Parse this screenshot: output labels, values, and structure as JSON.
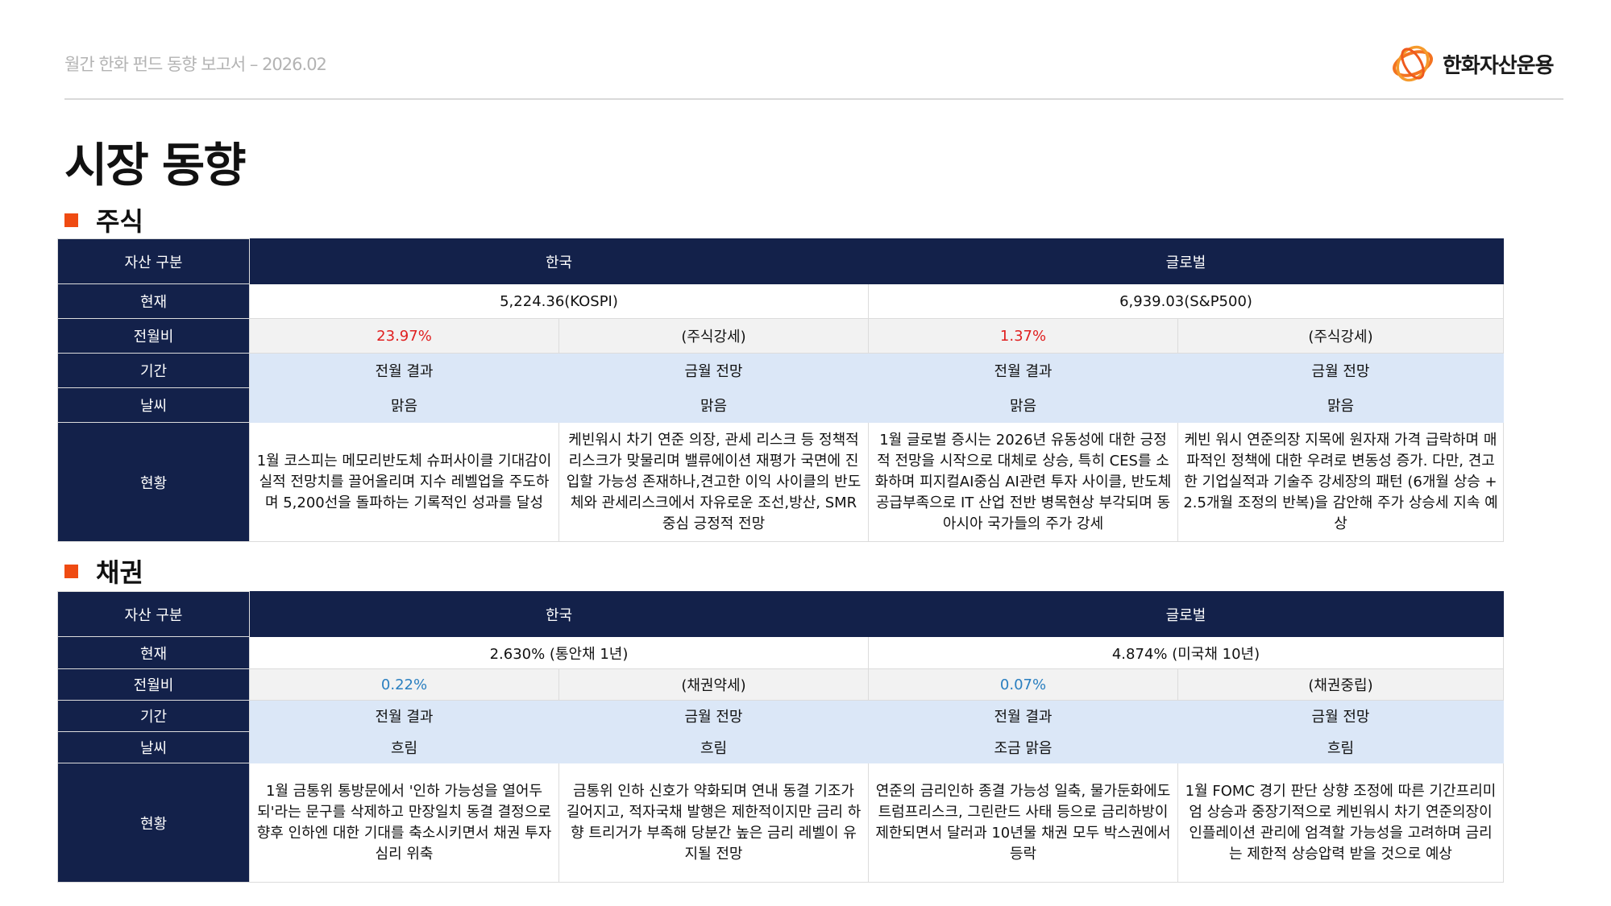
{
  "header": {
    "report_title": "월간 한화 펀드 동향 보고서 – 2026.02",
    "logo_text": "한화자산운용"
  },
  "page_title": "시장 동향",
  "colors": {
    "navy": "#13214a",
    "accent": "#ef4b12",
    "positive_red": "#e02020",
    "positive_blue": "#2a7fc0"
  },
  "stock": {
    "section_label": "주식",
    "rows": {
      "asset": "자산 구분",
      "current": "현재",
      "change": "전월비",
      "period": "기간",
      "weather": "날씨",
      "status": "현황"
    },
    "korea": {
      "label": "한국",
      "current": "5,224.36(KOSPI)",
      "change": "23.97%",
      "change_note": "(주식강세)",
      "period_prev": "전월 결과",
      "period_next": "금월 전망",
      "weather_prev": "맑음",
      "weather_next": "맑음",
      "status_prev": "1월 코스피는 메모리반도체 슈퍼사이클 기대감이 실적 전망치를 끌어올리며 지수 레벨업을 주도하며 5,200선을 돌파하는 기록적인 성과를 달성",
      "status_next": "케빈워시 차기 연준 의장, 관세 리스크 등 정책적 리스크가 맞물리며 밸류에이션 재평가 국면에 진입할 가능성 존재하나,견고한 이익 사이클의 반도체와 관세리스크에서 자유로운 조선,방산, SMR 중심 긍정적 전망"
    },
    "global": {
      "label": "글로벌",
      "current": "6,939.03(S&P500)",
      "change": "1.37%",
      "change_note": "(주식강세)",
      "period_prev": "전월 결과",
      "period_next": "금월 전망",
      "weather_prev": "맑음",
      "weather_next": "맑음",
      "status_prev": "1월 글로벌 증시는 2026년 유동성에 대한 긍정적 전망을 시작으로 대체로 상승, 특히 CES를 소화하며 피지컬AI중심 AI관련 투자 사이클, 반도체 공급부족으로 IT 산업 전반 병목현상 부각되며 동아시아 국가들의 주가 강세",
      "status_next": "케빈 워시 연준의장 지목에 원자재 가격 급락하며 매파적인 정책에 대한 우려로 변동성 증가. 다만, 견고한 기업실적과 기술주 강세장의 패턴 (6개월 상승 + 2.5개월 조정의 반복)을 감안해 주가 상승세 지속 예상"
    }
  },
  "bond": {
    "section_label": "채권",
    "rows": {
      "asset": "자산 구분",
      "current": "현재",
      "change": "전월비",
      "period": "기간",
      "weather": "날씨",
      "status": "현황"
    },
    "korea": {
      "label": "한국",
      "current": "2.630% (통안채 1년)",
      "change": "0.22%",
      "change_note": "(채권약세)",
      "period_prev": "전월 결과",
      "period_next": "금월 전망",
      "weather_prev": "흐림",
      "weather_next": "흐림",
      "status_prev": "1월 금통위 통방문에서 '인하 가능성을 열어두되'라는 문구를 삭제하고 만장일치 동결 결정으로 향후 인하엔 대한 기대를 축소시키면서 채권 투자심리 위축",
      "status_next": "금통위 인하 신호가 약화되며 연내 동결 기조가 길어지고, 적자국채 발행은 제한적이지만 금리 하향 트리거가 부족해 당분간 높은 금리 레벨이 유지될 전망"
    },
    "global": {
      "label": "글로벌",
      "current": "4.874% (미국채 10년)",
      "change": "0.07%",
      "change_note": "(채권중립)",
      "period_prev": "전월 결과",
      "period_next": "금월 전망",
      "weather_prev": "조금 맑음",
      "weather_next": "흐림",
      "status_prev": "연준의 금리인하 종결 가능성 일축, 물가둔화에도 트럼프리스크, 그린란드 사태 등으로 금리하방이 제한되면서 달러과 10년물 채권 모두 박스권에서 등락",
      "status_next": "1월 FOMC 경기 판단 상향 조정에 따른 기간프리미엄 상승과 중장기적으로 케빈워시 차기 연준의장이 인플레이션 관리에 엄격할 가능성을 고려하며 금리는 제한적 상승압력 받을 것으로 예상"
    }
  }
}
